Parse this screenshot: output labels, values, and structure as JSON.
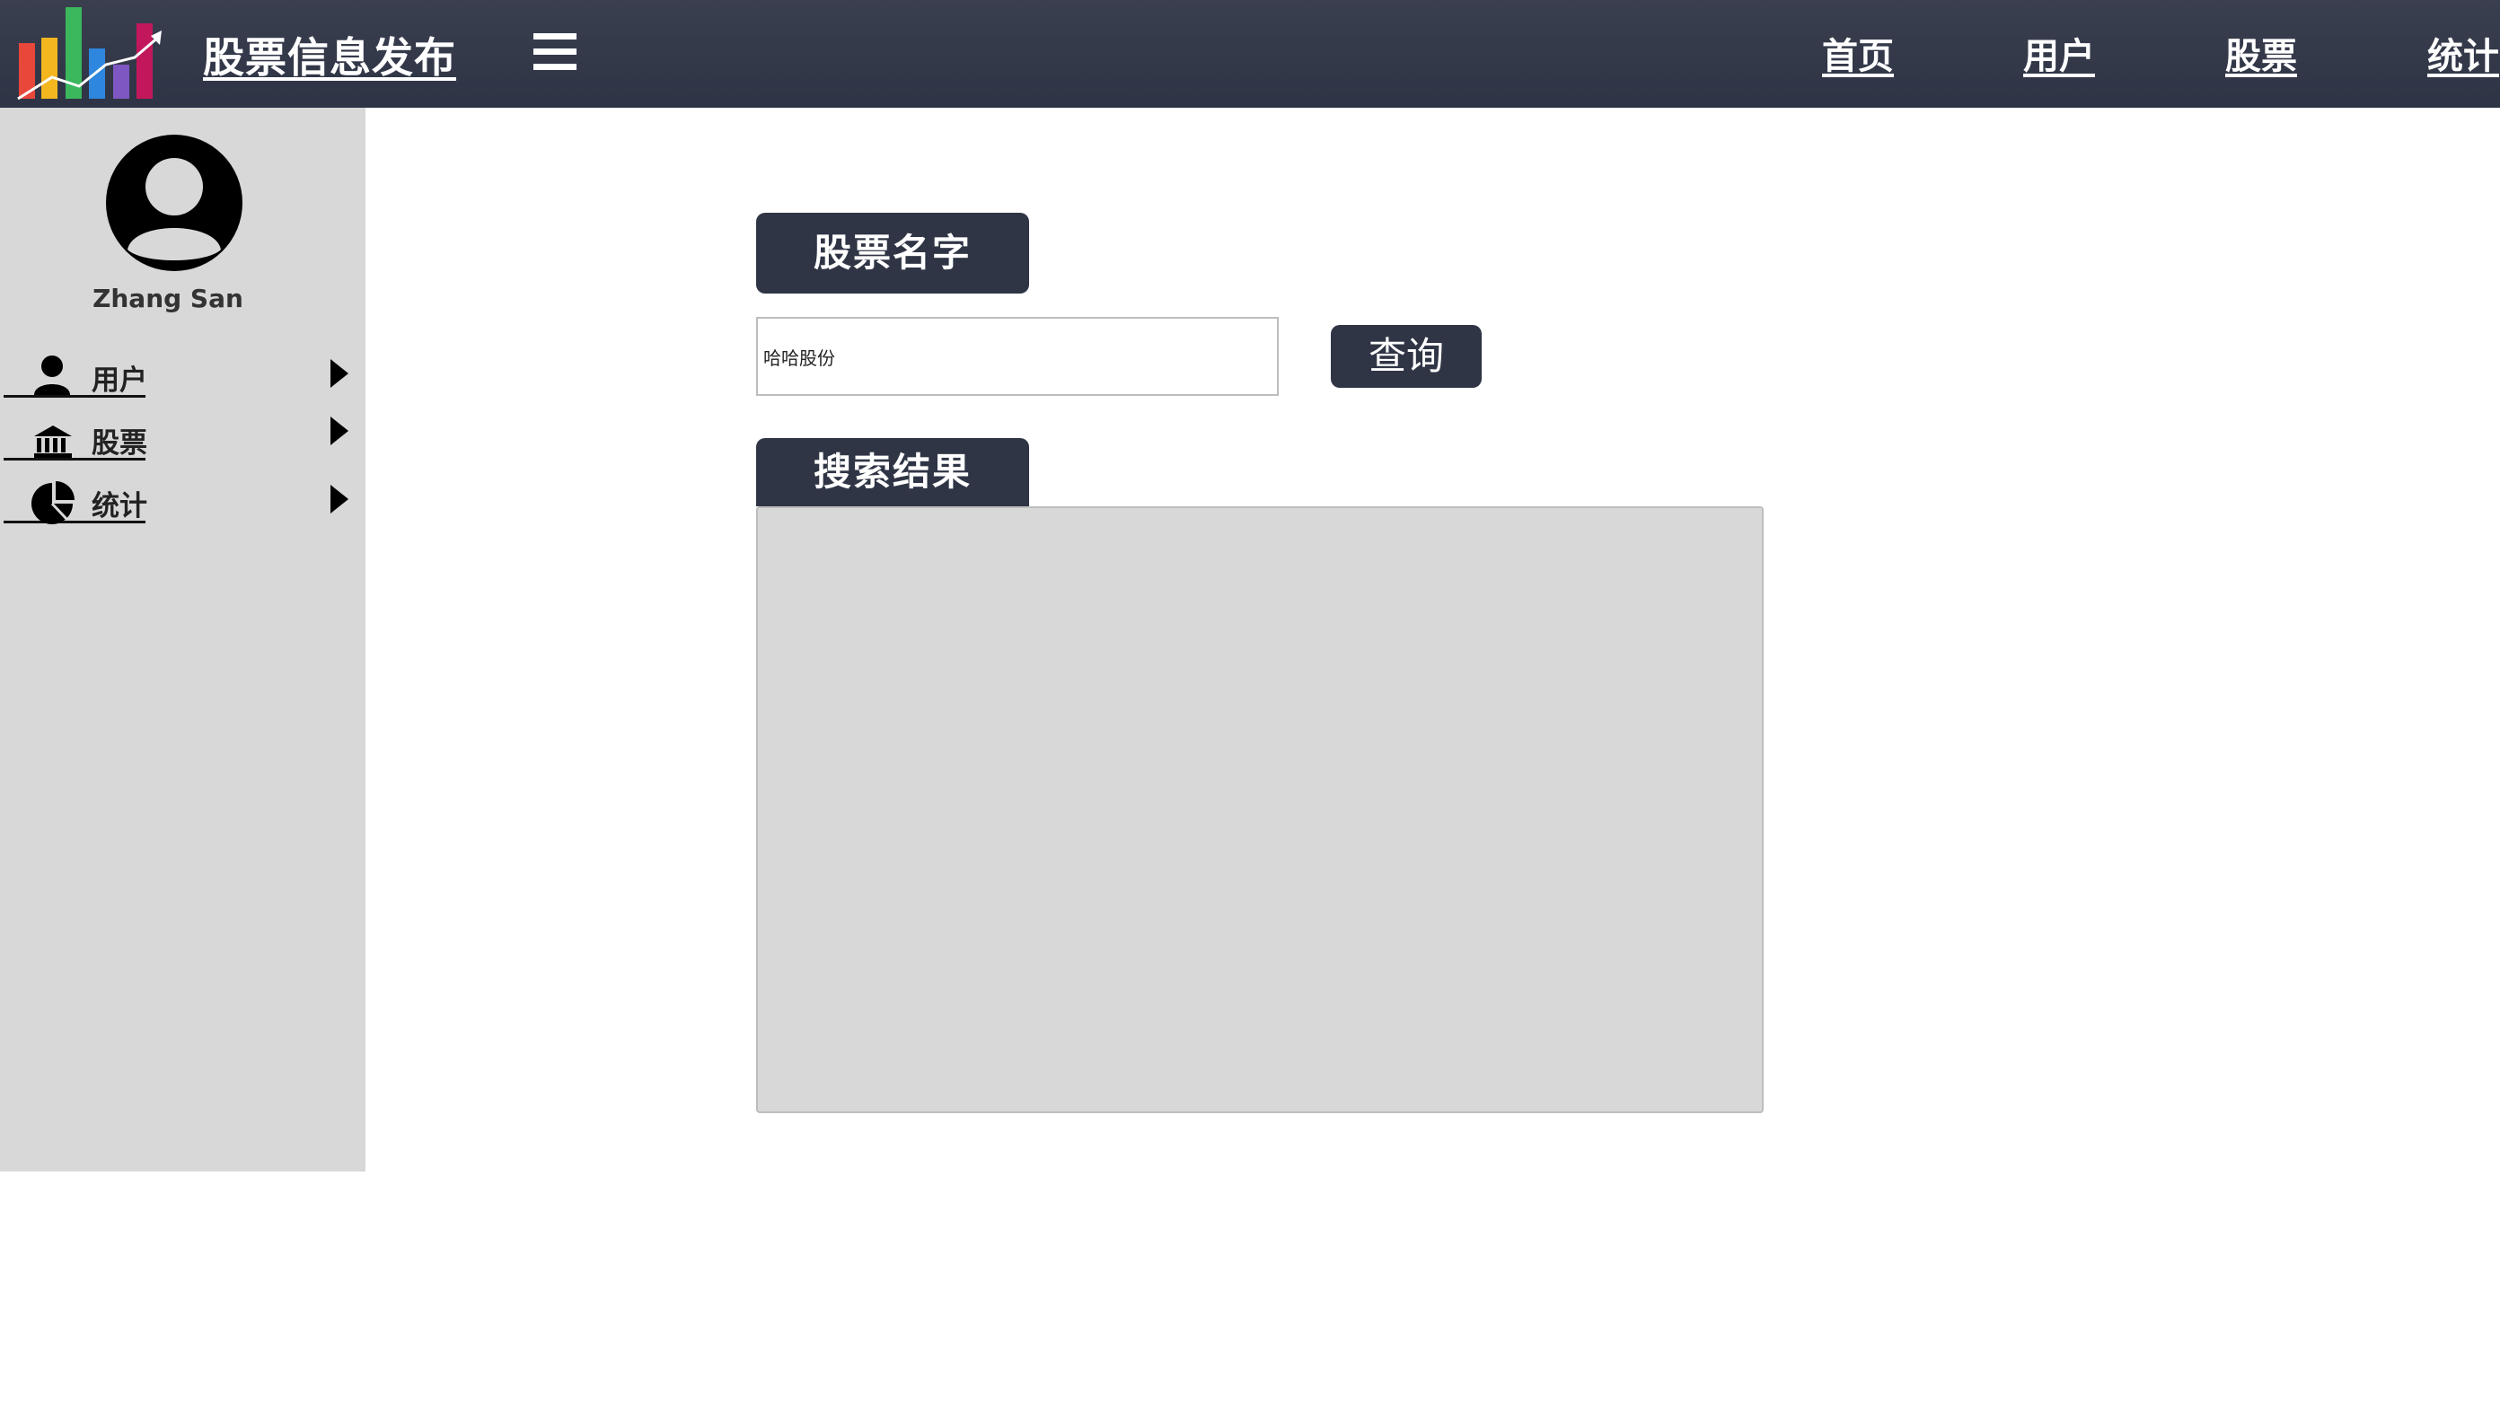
{
  "header": {
    "app_title": "股票信息发布",
    "nav": [
      {
        "label": "首页"
      },
      {
        "label": "用户"
      },
      {
        "label": "股票"
      },
      {
        "label": "统计"
      }
    ]
  },
  "sidebar": {
    "username": "Zhang San",
    "items": [
      {
        "label": "用户",
        "icon": "user-icon"
      },
      {
        "label": "股票",
        "icon": "bank-icon"
      },
      {
        "label": "统计",
        "icon": "pie-chart-icon"
      }
    ]
  },
  "main": {
    "stock_name_label": "股票名字",
    "search_value": "哈哈股份",
    "query_button": "查询",
    "results_label": "搜索结果"
  },
  "colors": {
    "topbar": "#2e3445",
    "accent_dark": "#2f3545",
    "sidebar_bg": "#d8d8d8",
    "results_bg": "#d8d8d8"
  }
}
